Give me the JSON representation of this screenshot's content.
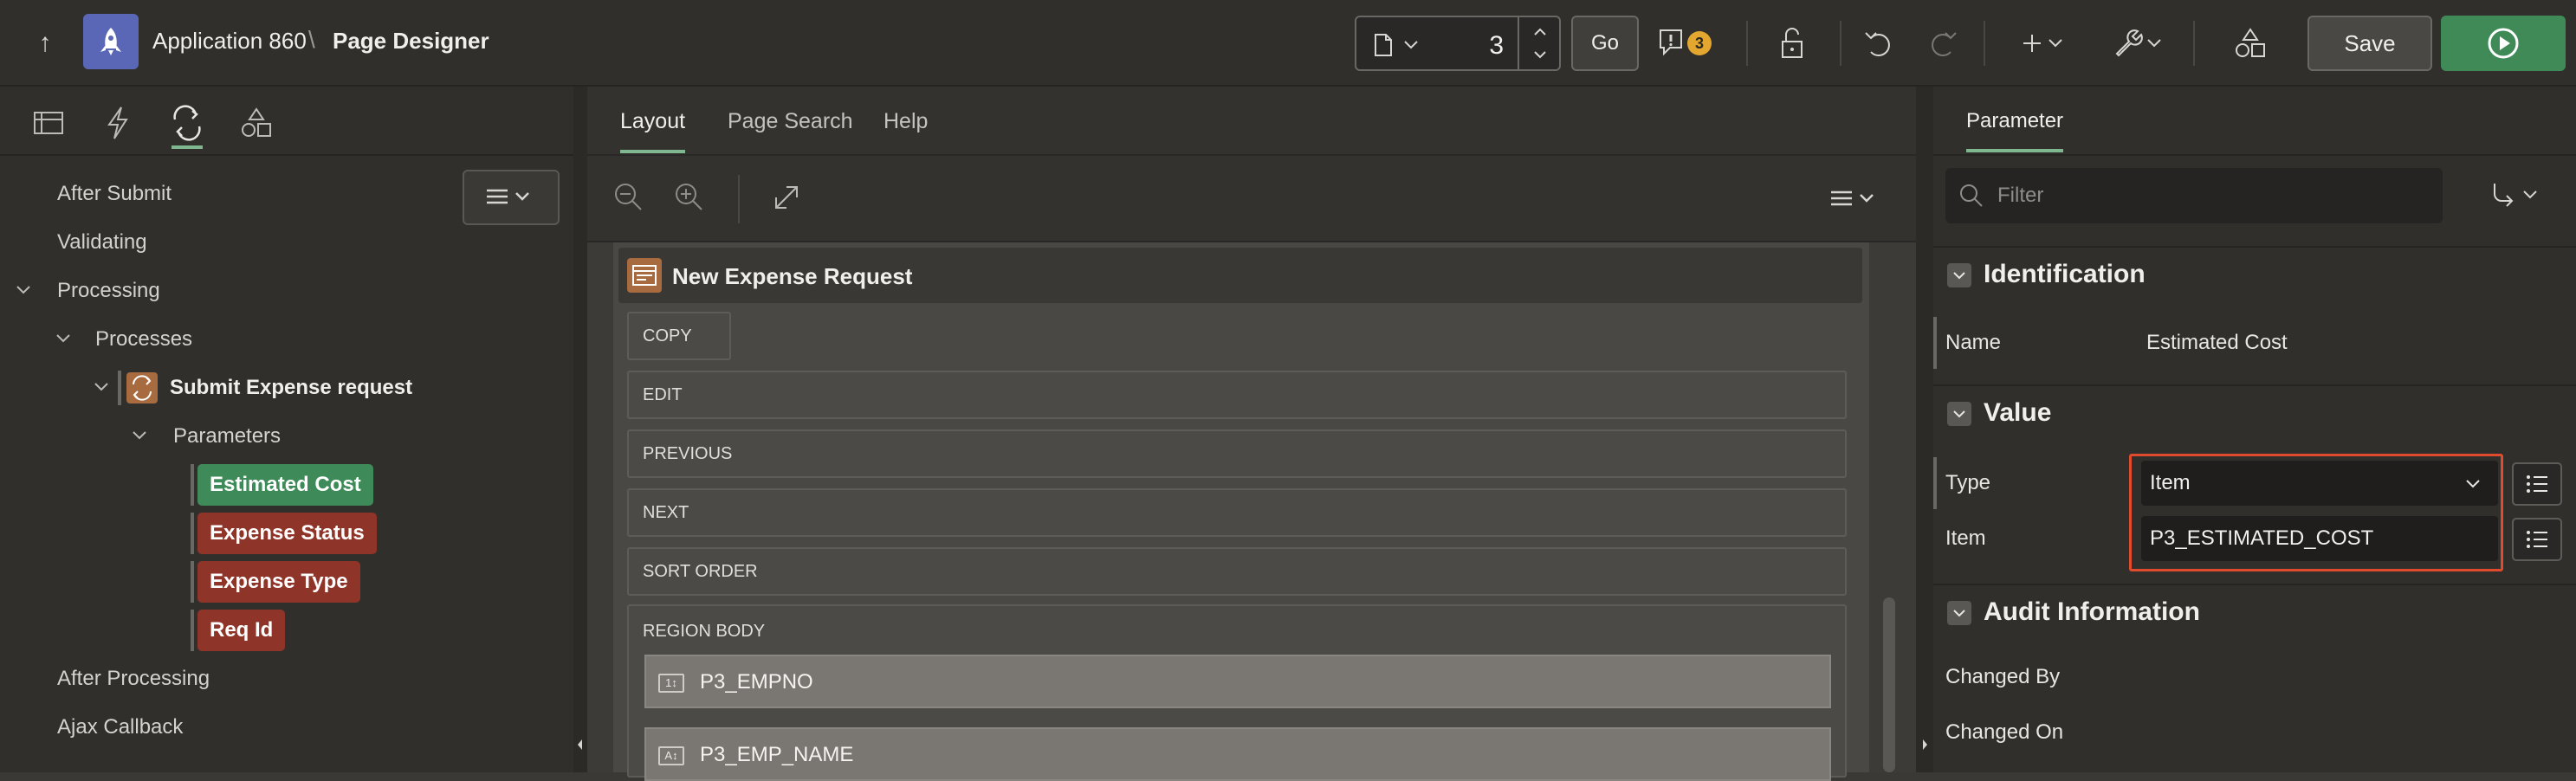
{
  "header": {
    "app_title": "Application 860",
    "separator": "\\",
    "page_title": "Page Designer",
    "page_number": "3",
    "go_label": "Go",
    "issues_count": "3",
    "save_label": "Save"
  },
  "left_panel": {
    "tree": [
      {
        "label": "After Submit"
      },
      {
        "label": "Validating"
      },
      {
        "label": "Processing"
      },
      {
        "label": "Processes"
      },
      {
        "label": "Submit Expense request"
      },
      {
        "label": "Parameters"
      },
      {
        "label": "Estimated Cost",
        "status": "selected"
      },
      {
        "label": "Expense Status",
        "status": "error"
      },
      {
        "label": "Expense Type",
        "status": "error"
      },
      {
        "label": "Req Id",
        "status": "error"
      },
      {
        "label": "After Processing"
      },
      {
        "label": "Ajax Callback"
      }
    ]
  },
  "center": {
    "tabs": [
      {
        "label": "Layout"
      },
      {
        "label": "Page Search"
      },
      {
        "label": "Help"
      }
    ],
    "region_title": "New Expense Request",
    "slots": [
      "COPY",
      "EDIT",
      "PREVIOUS",
      "NEXT",
      "SORT ORDER"
    ],
    "region_body_label": "REGION BODY",
    "fields": [
      {
        "label": "P3_EMPNO",
        "icon": "1↕"
      },
      {
        "label": "P3_EMP_NAME",
        "icon": "A↕"
      }
    ]
  },
  "right_panel": {
    "tab_label": "Parameter",
    "filter_placeholder": "Filter",
    "identification": {
      "title": "Identification",
      "name_label": "Name",
      "name_value": "Estimated Cost"
    },
    "value": {
      "title": "Value",
      "type_label": "Type",
      "type_value": "Item",
      "item_label": "Item",
      "item_value": "P3_ESTIMATED_COST"
    },
    "audit": {
      "title": "Audit Information",
      "changed_by_label": "Changed By",
      "changed_on_label": "Changed On"
    }
  },
  "colors": {
    "accent": "#7fb890",
    "success": "#3e8a58",
    "error": "#8e3428",
    "highlight": "#e04b2e"
  }
}
